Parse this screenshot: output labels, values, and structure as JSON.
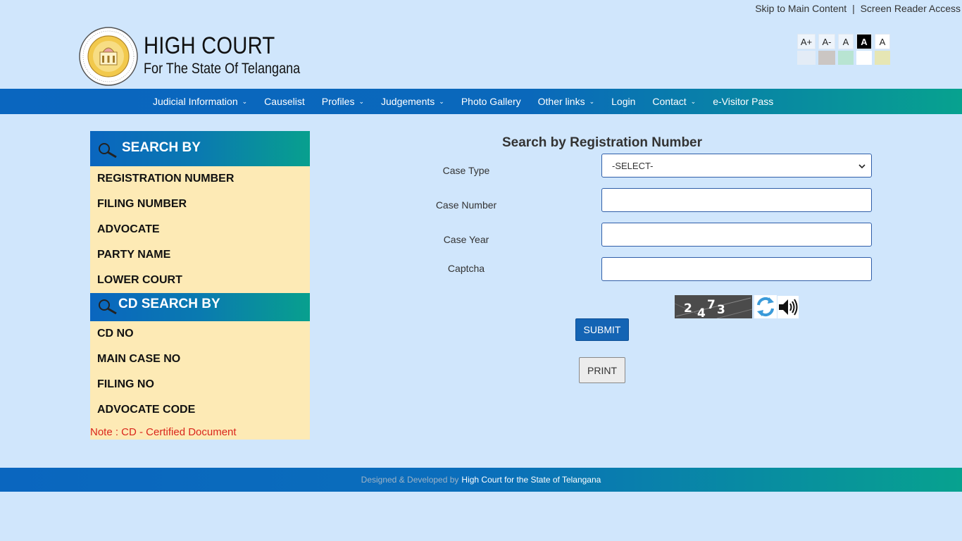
{
  "top_links": {
    "skip": "Skip to Main Content",
    "separator": "|",
    "screen_reader": "Screen Reader Access"
  },
  "header": {
    "title": "HIGH COURT",
    "subtitle": "For The State Of Telangana"
  },
  "accessibility": {
    "font_buttons": [
      "A+",
      "A-",
      "A",
      "A",
      "A"
    ],
    "color_swatches": [
      "#e3ecf6",
      "#cbc6c3",
      "#b8e4d2",
      "#ffffff",
      "#e6e6b4"
    ]
  },
  "nav": {
    "items": [
      {
        "label": "Judicial Information",
        "dropdown": true
      },
      {
        "label": "Causelist",
        "dropdown": false
      },
      {
        "label": "Profiles",
        "dropdown": true
      },
      {
        "label": "Judgements",
        "dropdown": true
      },
      {
        "label": "Photo Gallery",
        "dropdown": false
      },
      {
        "label": "Other links",
        "dropdown": true
      },
      {
        "label": "Login",
        "dropdown": false
      },
      {
        "label": "Contact",
        "dropdown": true
      },
      {
        "label": "e-Visitor Pass",
        "dropdown": false
      }
    ]
  },
  "sidebar": {
    "search_heading": "SEARCH BY",
    "search_items": [
      "REGISTRATION NUMBER",
      "FILING NUMBER",
      "ADVOCATE",
      "PARTY NAME",
      "LOWER COURT"
    ],
    "cd_heading": "CD SEARCH BY",
    "cd_items": [
      "CD NO",
      "MAIN CASE NO",
      "FILING NO",
      "ADVOCATE CODE"
    ],
    "note": "Note : CD - Certified Document"
  },
  "form": {
    "title": "Search by Registration Number",
    "case_type_label": "Case Type",
    "case_type_value": "-SELECT-",
    "case_number_label": "Case Number",
    "case_year_label": "Case Year",
    "captcha_label": "Captcha",
    "captcha_text": [
      "2",
      "4",
      "7",
      "3"
    ],
    "submit_label": "SUBMIT",
    "print_label": "PRINT"
  },
  "footer": {
    "prefix": "Designed & Developed by",
    "org": "High Court for the State of Telangana"
  }
}
